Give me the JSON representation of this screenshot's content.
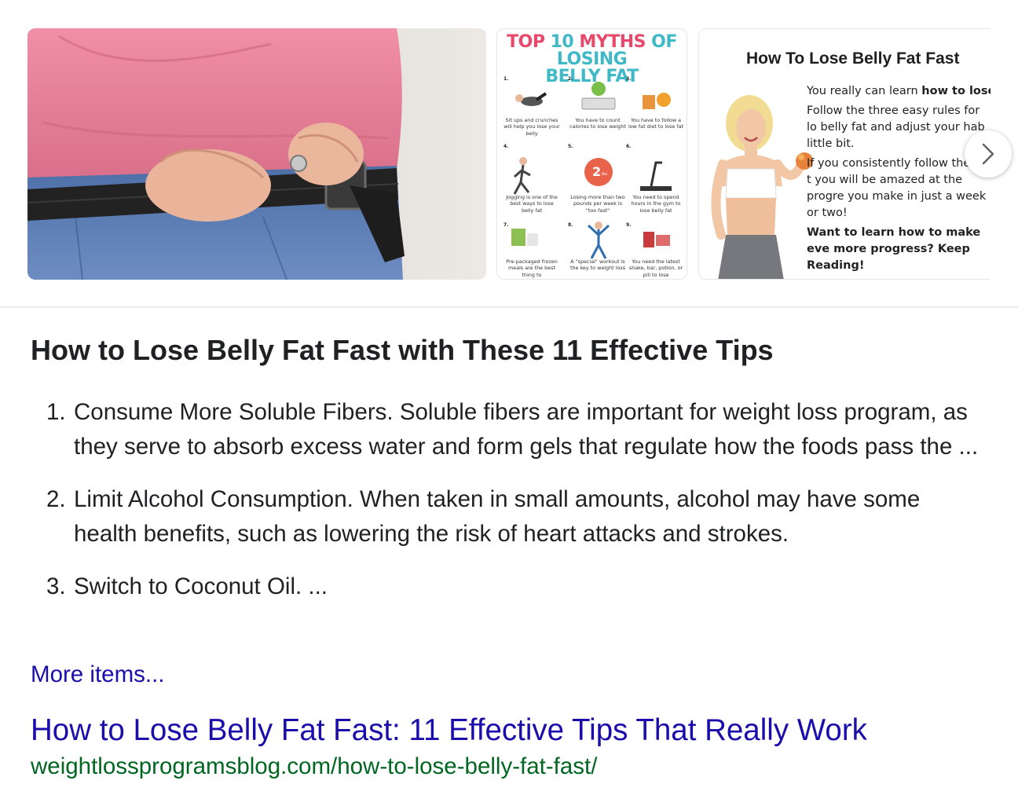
{
  "carousel": {
    "images": [
      {
        "alt": "man-with-belt-photo"
      },
      {
        "title_part1": "TOP ",
        "title_part2": "10 ",
        "title_part3": "MYTHS ",
        "title_part4": "OF LOSING",
        "title_line2": "BELLY FAT",
        "items": [
          {
            "num": "1.",
            "text": "Sit ups and crunches will help you lose your belly"
          },
          {
            "num": "2.",
            "text": "You have to count calories to lose weight"
          },
          {
            "num": "3.",
            "text": "You have to follow a low fat diet to lose fat"
          },
          {
            "num": "4.",
            "text": "Jogging is one of the best ways to lose belly fat"
          },
          {
            "num": "5.",
            "text": "Losing more than two pounds per week is \"too fast\""
          },
          {
            "num": "6.",
            "text": "You need to spend hours in the gym to lose belly fat"
          },
          {
            "num": "7.",
            "text": "Pre-packaged frozen meals are the best thing to"
          },
          {
            "num": "8.",
            "text": "A \"special\" workout is the key to weight loss"
          },
          {
            "num": "9.",
            "text": "You need the latest shake, bar, potion, or pill to lose"
          }
        ],
        "badge_number": "2",
        "badge_unit": "lbs"
      },
      {
        "title": "How To Lose Belly Fat Fast",
        "p1_pre": "You really can learn ",
        "p1_bold": "how to lose belly fat fast",
        "p1_post": "!",
        "p2": "Follow the three easy rules for lo belly fat and adjust your hab little bit.",
        "p3": "If you consistently follow these t you will be amazed at the progre you make in just a week or two!",
        "p4": "Want to learn how to make eve more progress?  Keep Reading!"
      }
    ],
    "next_icon": "chevron-right-icon"
  },
  "snippet": {
    "title": "How to Lose Belly Fat Fast with These 11 Effective Tips",
    "steps": [
      {
        "num": "1.",
        "text": "Consume More Soluble Fibers. Soluble fibers are important for weight loss program, as they serve to absorb excess water and form gels that regulate how the foods pass the ..."
      },
      {
        "num": "2.",
        "text": "Limit Alcohol Consumption. When taken in small amounts, alcohol may have some health benefits, such as lowering the risk of heart attacks and strokes."
      },
      {
        "num": "3.",
        "text": "Switch to Coconut Oil. ..."
      }
    ],
    "more_items": "More items...",
    "result_title": "How to Lose Belly Fat Fast: 11 Effective Tips That Really Work",
    "result_url": "weightlossprogramsblog.com/how-to-lose-belly-fat-fast/"
  },
  "colors": {
    "link": "#1a0dab",
    "url": "#006621",
    "text": "#202124"
  }
}
